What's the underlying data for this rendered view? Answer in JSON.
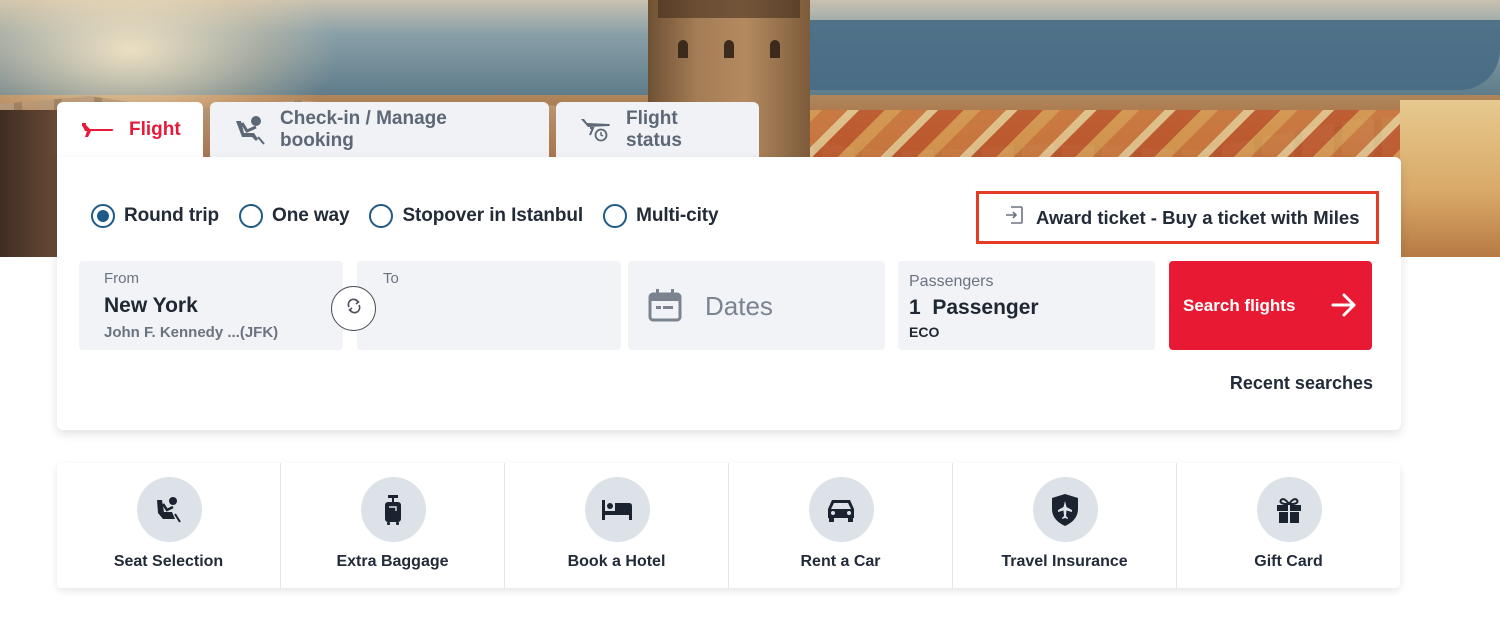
{
  "tabs": [
    {
      "id": "flight",
      "label": "Flight",
      "icon": "plane-icon",
      "active": true
    },
    {
      "id": "checkin",
      "label": "Check-in / Manage booking",
      "icon": "seat-icon",
      "active": false
    },
    {
      "id": "status",
      "label": "Flight status",
      "icon": "flight-status-icon",
      "active": false
    }
  ],
  "trip_types": [
    {
      "label": "Round trip",
      "checked": true
    },
    {
      "label": "One way",
      "checked": false
    },
    {
      "label": "Stopover in Istanbul",
      "checked": false
    },
    {
      "label": "Multi-city",
      "checked": false
    }
  ],
  "award": {
    "label": "Award ticket - Buy a ticket with Miles",
    "icon": "sign-in-icon"
  },
  "fields": {
    "from": {
      "label": "From",
      "city": "New York",
      "airport": "John F. Kennedy ...(JFK)"
    },
    "to": {
      "label": "To",
      "city": "",
      "airport": ""
    },
    "dates": {
      "placeholder": "Dates",
      "icon": "calendar-icon"
    },
    "passengers": {
      "label": "Passengers",
      "value": "1  Passenger",
      "cabin": "ECO"
    }
  },
  "swap_icon": "swap-icon",
  "search_button": {
    "label": "Search flights",
    "icon": "arrow-right-icon"
  },
  "recent_searches": "Recent searches",
  "services": [
    {
      "label": "Seat Selection",
      "icon": "seat-icon"
    },
    {
      "label": "Extra Baggage",
      "icon": "luggage-icon"
    },
    {
      "label": "Book a Hotel",
      "icon": "bed-icon"
    },
    {
      "label": "Rent a Car",
      "icon": "car-icon"
    },
    {
      "label": "Travel Insurance",
      "icon": "shield-plane-icon"
    },
    {
      "label": "Gift Card",
      "icon": "gift-icon"
    }
  ],
  "colors": {
    "brand_red": "#e81932",
    "radio_blue": "#1d5a86",
    "highlight_box": "#e53a24"
  }
}
